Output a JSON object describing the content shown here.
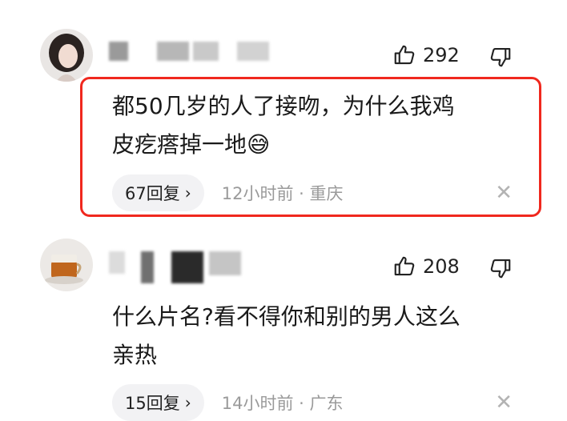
{
  "comments": [
    {
      "likes": "292",
      "text_line1": "都50几岁的人了接吻，为什么我鸡",
      "text_line2": "皮疙瘩掉一地",
      "emoji": "😅",
      "reply_count": "67回复",
      "time_location": "12小时前 · 重庆",
      "highlighted": true
    },
    {
      "likes": "208",
      "text_line1": "什么片名?看不得你和别的男人这么",
      "text_line2": "亲热",
      "reply_count": "15回复",
      "time_location": "14小时前 · 广东",
      "highlighted": false
    }
  ],
  "icons": {
    "like": "thumbs-up-icon",
    "dislike": "thumbs-down-icon",
    "close": "close-icon",
    "chevron": "chevron-right-icon"
  },
  "colors": {
    "highlight_border": "#f0281e",
    "pill_bg": "#f2f2f4",
    "meta_text": "#9a9a9a"
  }
}
